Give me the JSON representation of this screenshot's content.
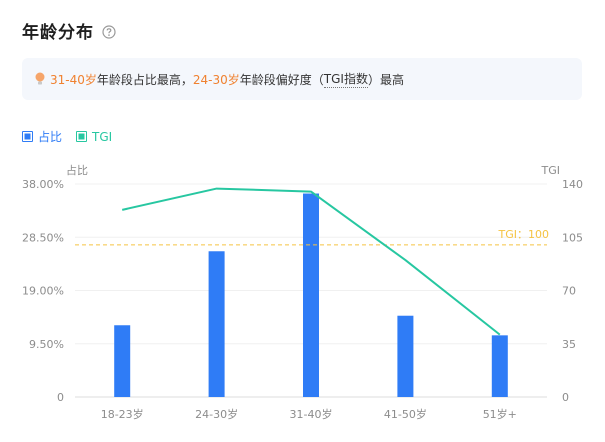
{
  "header": {
    "title": "年龄分布"
  },
  "tip": {
    "part1": "31-40岁",
    "part2": "年龄段占比最高，",
    "part3": "24-30岁",
    "part4": "年龄段偏好度（",
    "part5": "TGI指数",
    "part6": "）最高"
  },
  "colors": {
    "bar": "#2f7cf6",
    "line": "#27c7a1",
    "ref": "#f5c342",
    "highlight": "#f0812f"
  },
  "chart_data": {
    "type": "bar",
    "categories": [
      "18-23岁",
      "24-30岁",
      "31-40岁",
      "41-50岁",
      "51岁+"
    ],
    "series": [
      {
        "name": "占比",
        "type": "bar",
        "axis": "left",
        "values": [
          12.8,
          26.0,
          36.3,
          14.5,
          11.0
        ]
      },
      {
        "name": "TGI",
        "type": "line",
        "axis": "right",
        "values": [
          123,
          137,
          135,
          90,
          41
        ]
      }
    ],
    "left_axis": {
      "label": "占比",
      "ylim": [
        0,
        38
      ],
      "ticks": [
        "0",
        "9.50%",
        "19.00%",
        "28.50%",
        "38.00%"
      ]
    },
    "right_axis": {
      "label": "TGI",
      "ylim": [
        0,
        140
      ],
      "ticks": [
        "0",
        "35",
        "70",
        "105",
        "140"
      ]
    },
    "reference_line": {
      "label": "TGI：100",
      "value": 100,
      "axis": "right"
    },
    "legend_position": "top-left",
    "grid": true
  }
}
